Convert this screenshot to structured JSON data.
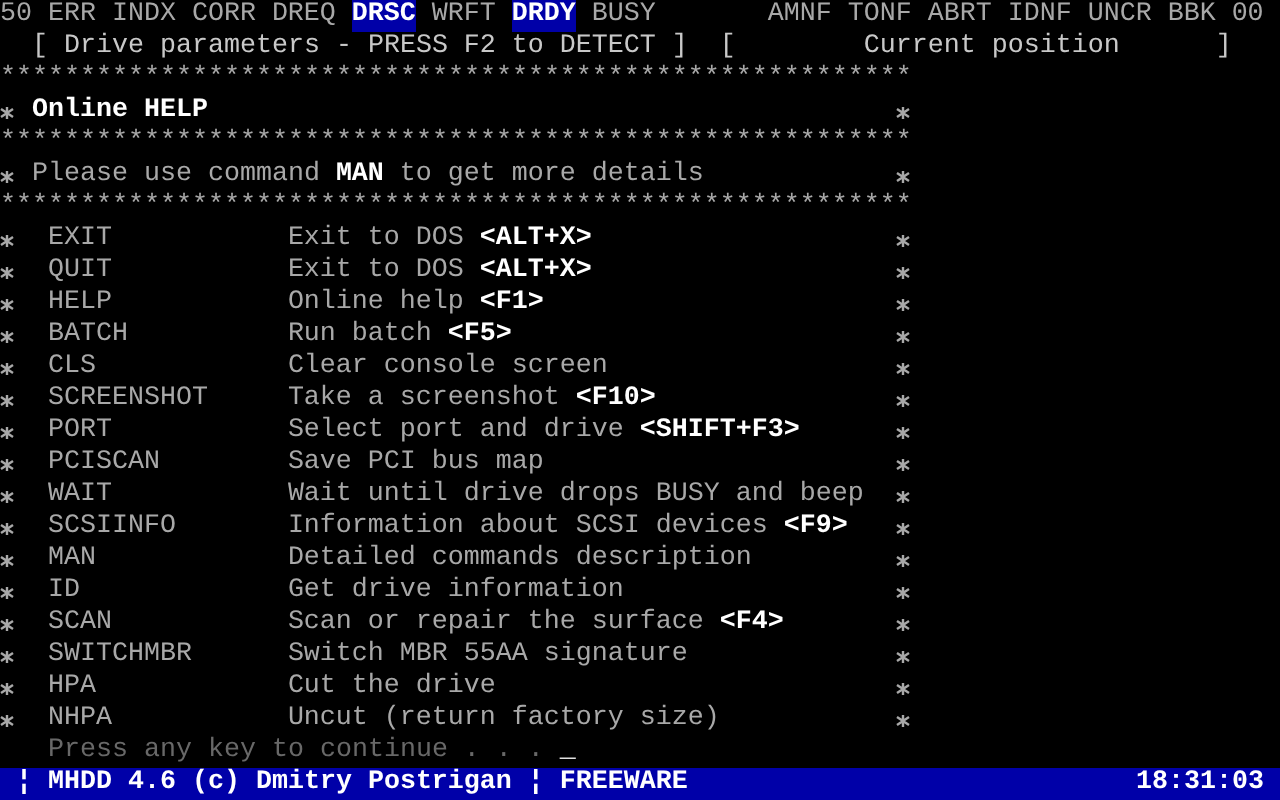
{
  "status_flags": {
    "left": [
      {
        "label": "50",
        "on": false
      },
      {
        "label": "ERR",
        "on": false
      },
      {
        "label": "INDX",
        "on": false
      },
      {
        "label": "CORR",
        "on": false
      },
      {
        "label": "DREQ",
        "on": false
      },
      {
        "label": "DRSC",
        "on": true
      },
      {
        "label": "WRFT",
        "on": false
      },
      {
        "label": "DRDY",
        "on": true
      },
      {
        "label": "BUSY",
        "on": false
      }
    ],
    "right": [
      {
        "label": "AMNF",
        "on": false
      },
      {
        "label": "TONF",
        "on": false
      },
      {
        "label": "ABRT",
        "on": false
      },
      {
        "label": "IDNF",
        "on": false
      },
      {
        "label": "UNCR",
        "on": false
      },
      {
        "label": "BBK",
        "on": false
      },
      {
        "label": "00",
        "on": false
      }
    ]
  },
  "header": {
    "drive_parameters": "[ Drive parameters - PRESS F2 to DETECT ]",
    "position_open": "[",
    "position_title": "Current position",
    "position_close": "]"
  },
  "help_box": {
    "rules": [
      "*********************************************************",
      "*********************************************************",
      "*********************************************************"
    ],
    "title": "Online HELP",
    "note": "Please use command **MAN** to get more details",
    "commands": [
      {
        "name": "EXIT",
        "description": "Exit to DOS **<ALT+X>**"
      },
      {
        "name": "QUIT",
        "description": "Exit to DOS **<ALT+X>**"
      },
      {
        "name": "HELP",
        "description": "Online help **<F1>**"
      },
      {
        "name": "BATCH",
        "description": "Run batch **<F5>**"
      },
      {
        "name": "CLS",
        "description": "Clear console screen"
      },
      {
        "name": "SCREENSHOT",
        "description": "Take a screenshot **<F10>**"
      },
      {
        "name": "PORT",
        "description": "Select port and drive **<SHIFT+F3>**"
      },
      {
        "name": "PCISCAN",
        "description": "Save PCI bus map"
      },
      {
        "name": "WAIT",
        "description": "Wait until drive drops BUSY and beep"
      },
      {
        "name": "SCSIINFO",
        "description": "Information about SCSI devices **<F9>**"
      },
      {
        "name": "MAN",
        "description": "Detailed commands description"
      },
      {
        "name": "ID",
        "description": "Get drive information"
      },
      {
        "name": "SCAN",
        "description": "Scan or repair the surface **<F4>**"
      },
      {
        "name": "SWITCHMBR",
        "description": "Switch MBR 55AA signature"
      },
      {
        "name": "HPA",
        "description": "Cut the drive"
      },
      {
        "name": "NHPA",
        "description": "Uncut (return factory size)"
      }
    ]
  },
  "prompt": {
    "text": "Press any key to continue . . .",
    "cursor": "_"
  },
  "status_bar": {
    "text": "¦ MHDD 4.6 (c) Dmitry Postrigan ¦ FREEWARE",
    "time": "18:31:03"
  }
}
